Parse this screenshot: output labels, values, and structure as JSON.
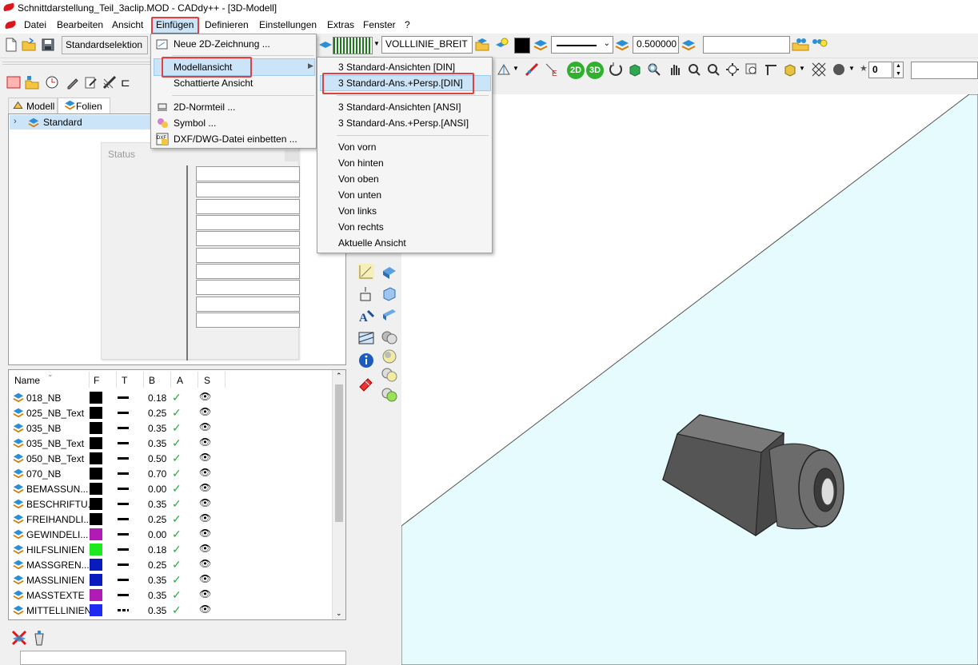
{
  "window": {
    "title": "Schnittdarstellung_Teil_3aclip.MOD  -  CADdy++ - [3D-Modell]"
  },
  "menubar": [
    "Datei",
    "Bearbeiten",
    "Ansicht",
    "Einfügen",
    "Definieren",
    "Einstellungen",
    "Extras",
    "Fenster",
    "?"
  ],
  "toolbar": {
    "selection": "Standardselektion",
    "linetype": "VOLLLINIE_BREIT",
    "linewidth": "0.500000",
    "step_value": "0",
    "view_2d": "2D",
    "view_3d": "3D",
    "e_label": "E"
  },
  "insert_menu": {
    "items": [
      "Neue 2D-Zeichnung ...",
      "Modellansicht",
      "Schattierte Ansicht",
      "2D-Normteil ...",
      "Symbol ...",
      "DXF/DWG-Datei einbetten ..."
    ]
  },
  "modelview_menu": {
    "items": [
      "3 Standard-Ansichten [DIN]",
      "3 Standard-Ans.+Persp.[DIN]",
      "3 Standard-Ansichten [ANSI]",
      "3 Standard-Ans.+Persp.[ANSI]",
      "Von vorn",
      "Von hinten",
      "Von oben",
      "Von unten",
      "Von links",
      "Von rechts",
      "Aktuelle Ansicht"
    ]
  },
  "panel": {
    "tabs": [
      "Modell",
      "Folien"
    ],
    "tree_root": "Standard",
    "status_label": "Status"
  },
  "layers": {
    "columns": [
      "Name",
      "F",
      "T",
      "B",
      "A",
      "S"
    ],
    "rows": [
      {
        "name": "018_NB",
        "color": "#000000",
        "width": "0.18",
        "linetype": "solid"
      },
      {
        "name": "025_NB_Text",
        "color": "#000000",
        "width": "0.25",
        "linetype": "solid"
      },
      {
        "name": "035_NB",
        "color": "#000000",
        "width": "0.35",
        "linetype": "solid"
      },
      {
        "name": "035_NB_Text",
        "color": "#000000",
        "width": "0.35",
        "linetype": "solid"
      },
      {
        "name": "050_NB_Text",
        "color": "#000000",
        "width": "0.50",
        "linetype": "solid"
      },
      {
        "name": "070_NB",
        "color": "#000000",
        "width": "0.70",
        "linetype": "solid"
      },
      {
        "name": "BEMASSUN...",
        "color": "#000000",
        "width": "0.00",
        "linetype": "solid"
      },
      {
        "name": "BESCHRIFTU...",
        "color": "#000000",
        "width": "0.35",
        "linetype": "solid"
      },
      {
        "name": "FREIHANDLI...",
        "color": "#000000",
        "width": "0.25",
        "linetype": "solid"
      },
      {
        "name": "GEWINDELI...",
        "color": "#b21ab5",
        "width": "0.00",
        "linetype": "solid"
      },
      {
        "name": "HILFSLINIEN",
        "color": "#1ee81e",
        "width": "0.18",
        "linetype": "solid"
      },
      {
        "name": "MASSGREN...",
        "color": "#0a1bbd",
        "width": "0.25",
        "linetype": "solid"
      },
      {
        "name": "MASSLINIEN",
        "color": "#0a1bbd",
        "width": "0.35",
        "linetype": "solid"
      },
      {
        "name": "MASSTEXTE",
        "color": "#b21ab5",
        "width": "0.35",
        "linetype": "solid"
      },
      {
        "name": "MITTELLINIEN",
        "color": "#1e2af0",
        "width": "0.35",
        "linetype": "dashdot"
      }
    ]
  }
}
